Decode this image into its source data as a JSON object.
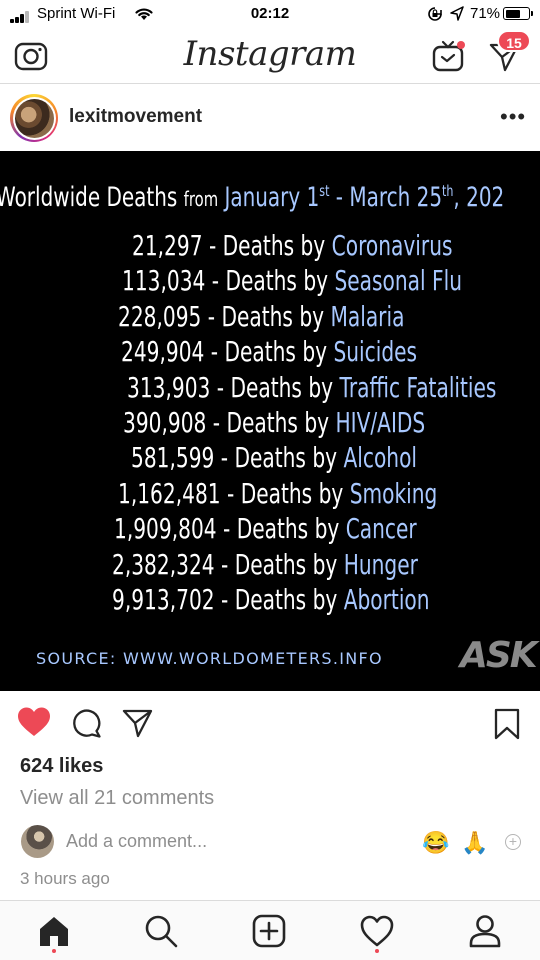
{
  "status_bar": {
    "carrier": "Sprint Wi-Fi",
    "time": "02:12",
    "battery": "71%",
    "battery_level": 0.71
  },
  "header": {
    "logo": "Instagram",
    "dm_badge": "15"
  },
  "post": {
    "username": "lexitmovement",
    "image": {
      "title_part1": "Worldwide Deaths",
      "title_from": "from",
      "title_part2a": "January 1",
      "title_sup1": "st",
      "title_dash": " - ",
      "title_part2b": "March 25",
      "title_sup2": "th",
      "title_part2c": ", 202",
      "rows": [
        {
          "count": "21,297",
          "sep": " - Deaths by ",
          "cause": "Coronavirus"
        },
        {
          "count": "113,034",
          "sep": " - Deaths by ",
          "cause": "Seasonal Flu"
        },
        {
          "count": "228,095",
          "sep": " - Deaths by ",
          "cause": "Malaria"
        },
        {
          "count": "249,904",
          "sep": " - Deaths by ",
          "cause": "Suicides"
        },
        {
          "count": "313,903",
          "sep": " - Deaths by ",
          "cause": "Traffic Fatalities"
        },
        {
          "count": "390,908",
          "sep": " - Deaths by ",
          "cause": "HIV/AIDS"
        },
        {
          "count": "581,599",
          "sep": " - Deaths by ",
          "cause": "Alcohol"
        },
        {
          "count": "1,162,481",
          "sep": " - Deaths by ",
          "cause": "Smoking"
        },
        {
          "count": "1,909,804",
          "sep": " - Deaths by ",
          "cause": "Cancer"
        },
        {
          "count": "2,382,324",
          "sep": " - Deaths by ",
          "cause": "Hunger"
        },
        {
          "count": "9,913,702",
          "sep": " - Deaths by ",
          "cause": "Abortion"
        }
      ],
      "source": "SOURCE: WWW.WORLDOMETERS.INFO",
      "watermark": "ASK"
    },
    "likes": "624 likes",
    "view_comments": "View all 21 comments",
    "comment_placeholder": "Add a comment...",
    "quick_emojis": [
      "😂",
      "🙏"
    ],
    "timestamp": "3 hours ago"
  },
  "colors": {
    "accent_red": "#ed4956",
    "image_text_blue": "#a8c8ff",
    "muted_text": "#8e8e8e"
  },
  "nav": {
    "items": [
      "home-icon",
      "search-icon",
      "new-post-icon",
      "activity-icon",
      "profile-icon"
    ]
  }
}
